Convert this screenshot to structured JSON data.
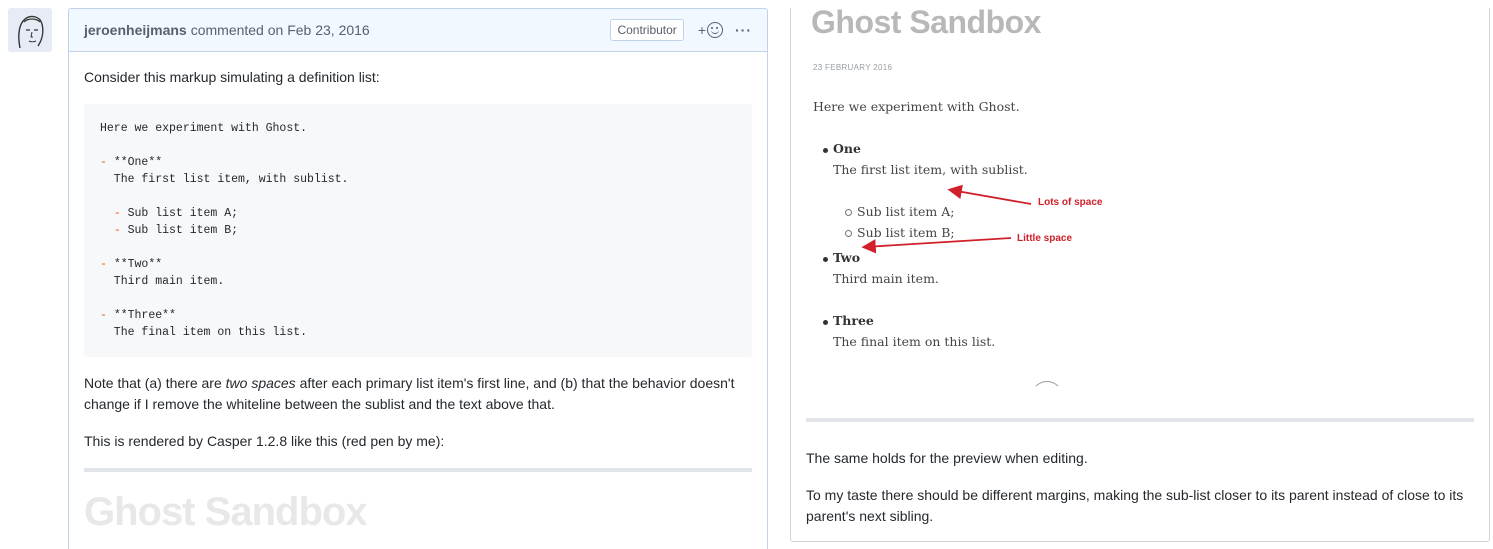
{
  "comment": {
    "author": "jeroenheijmans",
    "meta": "commented on Feb 23, 2016",
    "badge": "Contributor",
    "reaction_plus": "+",
    "more": "···",
    "intro": "Consider this markup simulating a definition list:",
    "code": {
      "line1": "Here we experiment with Ghost.",
      "l_one": "**One**",
      "l_one_desc": "  The first list item, with sublist.",
      "l_sub_a": " Sub list item A;",
      "l_sub_b": " Sub list item B;",
      "l_two": "**Two**",
      "l_two_desc": "  Third main item.",
      "l_three": "**Three**",
      "l_three_desc": "  The final item on this list."
    },
    "note_a": "Note that (a) there are ",
    "note_em": "two spaces",
    "note_b": " after each primary list item's first line, and (b) that the behavior doesn't change if I remove the whiteline between the sublist and the text above that.",
    "rendered": "This is rendered by Casper 1.2.8 like this (red pen by me):",
    "cut_title": "Ghost Sandbox"
  },
  "preview": {
    "title": "Ghost Sandbox",
    "date": "23 FEBRUARY 2016",
    "intro": "Here we experiment with Ghost.",
    "item_one": "One",
    "item_one_desc": "The first list item, with sublist.",
    "sub_a": "Sub list item A;",
    "sub_b": "Sub list item B;",
    "item_two": "Two",
    "item_two_desc": "Third main item.",
    "item_three": "Three",
    "item_three_desc": "The final item on this list.",
    "annotation_lots": "Lots of space",
    "annotation_little": "Little space"
  },
  "right_comment": {
    "p1": "The same holds for the preview when editing.",
    "p2": "To my taste there should be different margins, making the sub-list closer to its parent instead of close to its parent's next sibling."
  },
  "colors": {
    "annotation": "#d0202a",
    "header_bg": "#f1f8ff",
    "dash": "#e36209"
  }
}
